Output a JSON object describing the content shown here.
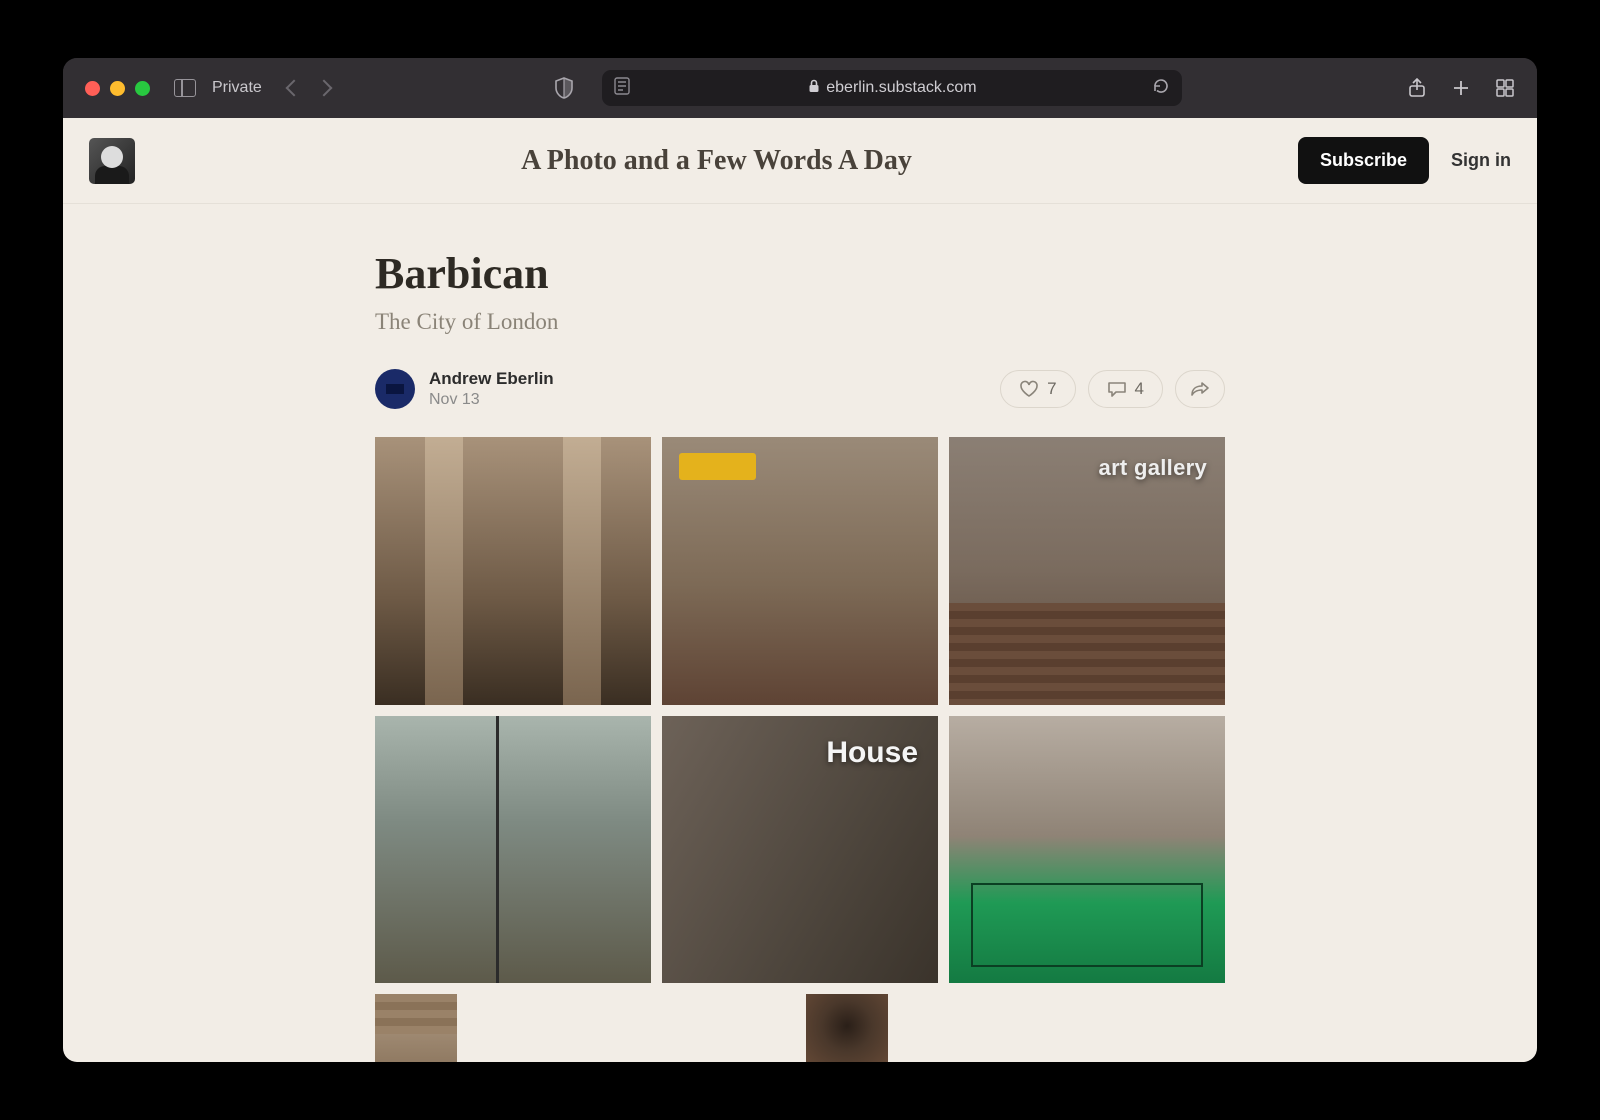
{
  "browser": {
    "private_label": "Private",
    "url_host": "eberlin.substack.com"
  },
  "site": {
    "title": "A Photo and a Few Words A Day",
    "subscribe_label": "Subscribe",
    "signin_label": "Sign in"
  },
  "post": {
    "title": "Barbican",
    "subtitle": "The City of London",
    "author": "Andrew Eberlin",
    "date": "Nov 13",
    "likes": "7",
    "comments": "4"
  },
  "photos": {
    "p3_label": "art gallery",
    "p5_label": "House"
  }
}
